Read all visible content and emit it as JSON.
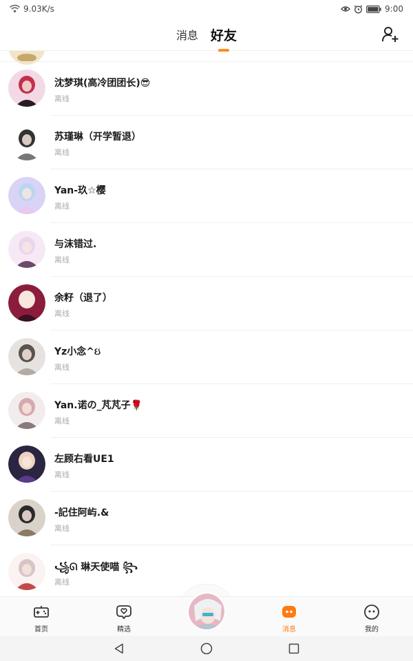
{
  "status_bar": {
    "speed": "9.03K/s",
    "time": "9:00"
  },
  "header": {
    "tabs": [
      {
        "label": "消息",
        "active": false
      },
      {
        "label": "好友",
        "active": true
      }
    ],
    "accent": "#ff8a1e"
  },
  "friends": [
    {
      "name": "沈梦琪(高冷团团长)😎",
      "status": "离线",
      "colors": [
        "#f3d9e6",
        "#c4304a",
        "#2a1a22"
      ]
    },
    {
      "name": "苏瑾琳（开学暂退）",
      "status": "离线",
      "colors": [
        "#ffffff",
        "#333333",
        "#777777"
      ]
    },
    {
      "name": "Yan-玖☆樱",
      "status": "离线",
      "colors": [
        "#d9d3f5",
        "#b9d6f2",
        "#e8c9f0"
      ]
    },
    {
      "name": "与沫错过.",
      "status": "离线",
      "colors": [
        "#f6e9f5",
        "#e9d6ee",
        "#6c4a6a"
      ]
    },
    {
      "name": "余籽（退了）",
      "status": "离线",
      "colors": [
        "#8c1c3c",
        "#f5e6e0",
        "#3a1020"
      ]
    },
    {
      "name": "Yz小念^ઇ",
      "status": "离线",
      "colors": [
        "#e6e2df",
        "#5a5350",
        "#b3aaa3"
      ]
    },
    {
      "name": "Yan.诺の_芃芃子🌹",
      "status": "离线",
      "colors": [
        "#f3ecec",
        "#d7a8b0",
        "#8a7a7a"
      ]
    },
    {
      "name": "左顾右看UE1",
      "status": "离线",
      "colors": [
        "#2a2540",
        "#f0d2c2",
        "#5b3a8a"
      ]
    },
    {
      "name": "-記住阿屿.&",
      "status": "离线",
      "colors": [
        "#d8d2c8",
        "#2a2a2a",
        "#8a7a66"
      ]
    },
    {
      "name": "꧁ᘏ 琳天使喵 ꧂",
      "status": "离线",
      "colors": [
        "#fbf2f2",
        "#d8c3c8",
        "#c44a4a"
      ]
    }
  ],
  "bottom_nav": {
    "items": [
      {
        "label": "首页",
        "icon": "gamepad-icon",
        "active": false
      },
      {
        "label": "精选",
        "icon": "heart-chat-icon",
        "active": false
      },
      {
        "label": "消息",
        "icon": "message-face-icon",
        "active": true
      },
      {
        "label": "我的",
        "icon": "smile-face-icon",
        "active": false
      }
    ],
    "active_color": "#ff7a12"
  }
}
